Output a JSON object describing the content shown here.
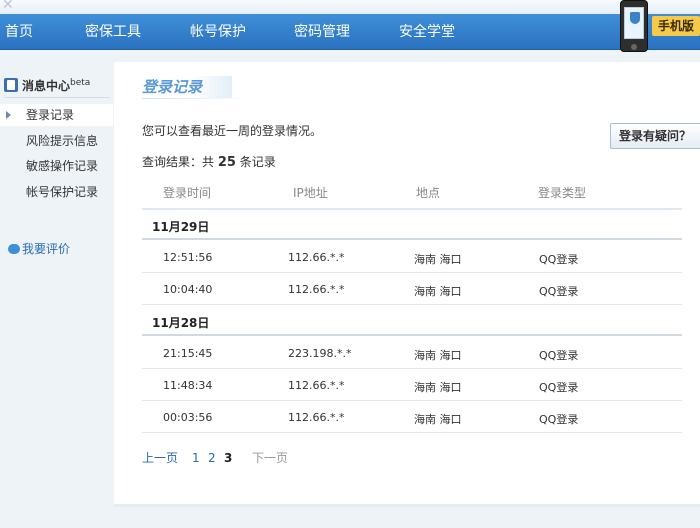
{
  "nav": {
    "items": [
      "首页",
      "密保工具",
      "帐号保护",
      "密码管理",
      "安全学堂"
    ],
    "mobile_tag": "手机版"
  },
  "sidebar": {
    "header": "消息中心",
    "header_sup": "beta",
    "items": [
      "登录记录",
      "风险提示信息",
      "敏感操作记录",
      "帐号保护记录"
    ],
    "active_index": 0,
    "review": "我要评价"
  },
  "main": {
    "title": "登录记录",
    "intro": "您可以查看最近一周的登录情况。",
    "question_button": "登录有疑问？",
    "result_prefix": "查询结果：共",
    "result_count": "25",
    "result_suffix": "条记录",
    "columns": [
      "登录时间",
      "IP地址",
      "地点",
      "登录类型"
    ],
    "groups": [
      {
        "date": "11月29日",
        "rows": [
          [
            "12:51:56",
            "112.66.*.*",
            "海南  海口",
            "QQ登录"
          ],
          [
            "10:04:40",
            "112.66.*.*",
            "海南  海口",
            "QQ登录"
          ]
        ]
      },
      {
        "date": "11月28日",
        "rows": [
          [
            "21:15:45",
            "223.198.*.*",
            "海南  海口",
            "QQ登录"
          ],
          [
            "11:48:34",
            "112.66.*.*",
            "海南  海口",
            "QQ登录"
          ],
          [
            "00:03:56",
            "112.66.*.*",
            "海南  海口",
            "QQ登录"
          ]
        ]
      }
    ],
    "pager": {
      "prev": "上一页",
      "pages": [
        "1",
        "2",
        "3"
      ],
      "current": "3",
      "next": "下一页"
    }
  },
  "colors": {
    "nav_bg": "#2a72c0",
    "link": "#2a6bb3",
    "title": "#5a9ad4"
  }
}
